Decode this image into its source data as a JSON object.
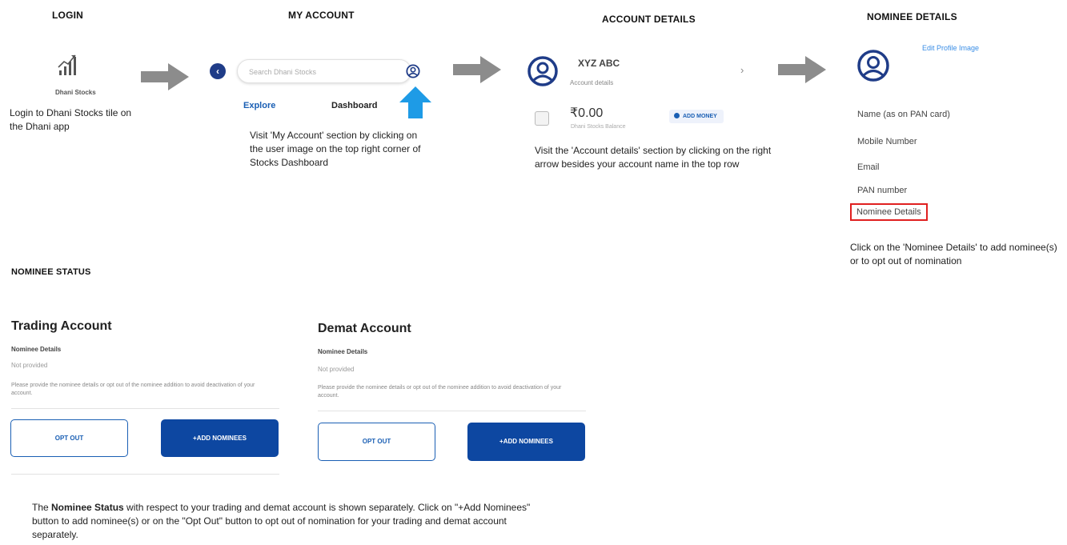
{
  "steps": {
    "login": {
      "title": "LOGIN",
      "app_label": "Dhani Stocks",
      "description": "Login to Dhani Stocks tile on the Dhani app"
    },
    "my_account": {
      "title": "MY ACCOUNT",
      "search_placeholder": "Search Dhani Stocks",
      "tab_explore": "Explore",
      "tab_dashboard": "Dashboard",
      "description": "Visit 'My Account' section by clicking on the user image on the top right corner of Stocks Dashboard"
    },
    "account_details": {
      "title": "ACCOUNT DETAILS",
      "account_name": "XYZ ABC",
      "account_sub": "Account details",
      "balance": "₹0.00",
      "balance_label": "Dhani Stocks Balance",
      "add_money": "ADD MONEY",
      "description": "Visit the 'Account details' section by  clicking on the right arrow besides your account name in the top row"
    },
    "nominee_details": {
      "title": "NOMINEE DETAILS",
      "edit_profile": "Edit Profile Image",
      "items": [
        "Name (as on PAN card)",
        "Mobile Number",
        "Email",
        "PAN number"
      ],
      "highlighted_item": "Nominee Details",
      "description": "Click on the 'Nominee Details' to add nominee(s) or to opt out of nomination"
    }
  },
  "nominee_status": {
    "title": "NOMINEE STATUS",
    "cards": [
      {
        "title": "Trading Account",
        "label": "Nominee Details",
        "status": "Not provided",
        "message": "Please provide the nominee details or opt out of the nominee addition to avoid deactivation of your account.",
        "opt_out": "OPT OUT",
        "add": "+ADD NOMINEES"
      },
      {
        "title": "Demat Account",
        "label": "Nominee Details",
        "status": "Not provided",
        "message": "Please provide the nominee details or opt out of the nominee addition to avoid deactivation of your account.",
        "opt_out": "OPT OUT",
        "add": "+ADD NOMINEES"
      }
    ],
    "footer_bold": "Nominee Status",
    "footer_pre": "The ",
    "footer_post": " with respect to your trading and demat account is shown separately. Click on \"+Add Nominees\" button to add nominee(s) or on the \"Opt Out\" button to opt out of nomination for your trading and demat account separately."
  },
  "colors": {
    "brand_blue": "#0d47a1",
    "link_blue": "#1a5fb4",
    "arrow_gray": "#8c8c8c",
    "pointer_blue": "#1e9be6",
    "highlight_red": "#e02020"
  }
}
